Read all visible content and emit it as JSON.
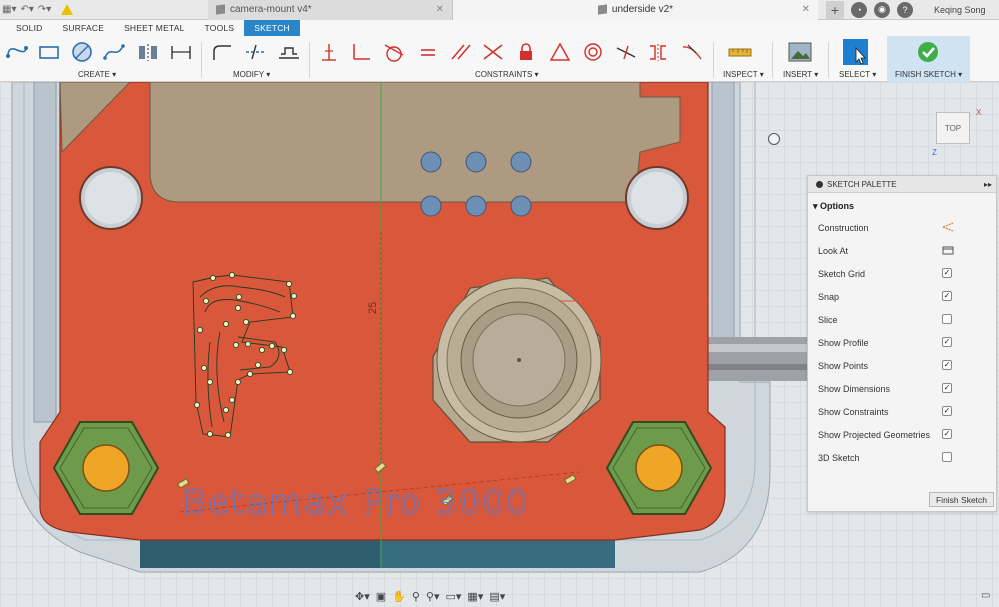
{
  "titlebar": {
    "tabs": [
      {
        "label": "camera-mount v4*",
        "active": false
      },
      {
        "label": "underside v2*",
        "active": true
      }
    ],
    "user": "Keqing Song"
  },
  "ribbon": {
    "tabs": [
      "SOLID",
      "SURFACE",
      "SHEET METAL",
      "TOOLS",
      "SKETCH"
    ],
    "active_tab": "SKETCH",
    "groups": {
      "create": "CREATE ▾",
      "modify": "MODIFY ▾",
      "constraints": "CONSTRAINTS ▾",
      "inspect": "INSPECT ▾",
      "insert": "INSERT ▾",
      "select": "SELECT ▾",
      "finish": "FINISH SKETCH ▾"
    }
  },
  "canvas": {
    "dimension_label": "25",
    "sketch_text": "Betamax Pro 3000"
  },
  "viewcube": {
    "face": "TOP",
    "axis_x": "X",
    "axis_z": "Z"
  },
  "palette": {
    "title": "SKETCH PALETTE",
    "section": "Options",
    "options": [
      {
        "label": "Construction",
        "type": "icon"
      },
      {
        "label": "Look At",
        "type": "icon"
      },
      {
        "label": "Sketch Grid",
        "checked": true
      },
      {
        "label": "Snap",
        "checked": true
      },
      {
        "label": "Slice",
        "checked": false
      },
      {
        "label": "Show Profile",
        "checked": true
      },
      {
        "label": "Show Points",
        "checked": true
      },
      {
        "label": "Show Dimensions",
        "checked": true
      },
      {
        "label": "Show Constraints",
        "checked": true
      },
      {
        "label": "Show Projected Geometries",
        "checked": true
      },
      {
        "label": "3D Sketch",
        "checked": false
      }
    ],
    "finish_button": "Finish Sketch"
  },
  "colors": {
    "accent": "#2a86c8",
    "part_orange": "#d9573b",
    "nut_green": "#6e9a4c",
    "hole_blue": "#6e8fb5",
    "finish_green": "#3fae49"
  }
}
